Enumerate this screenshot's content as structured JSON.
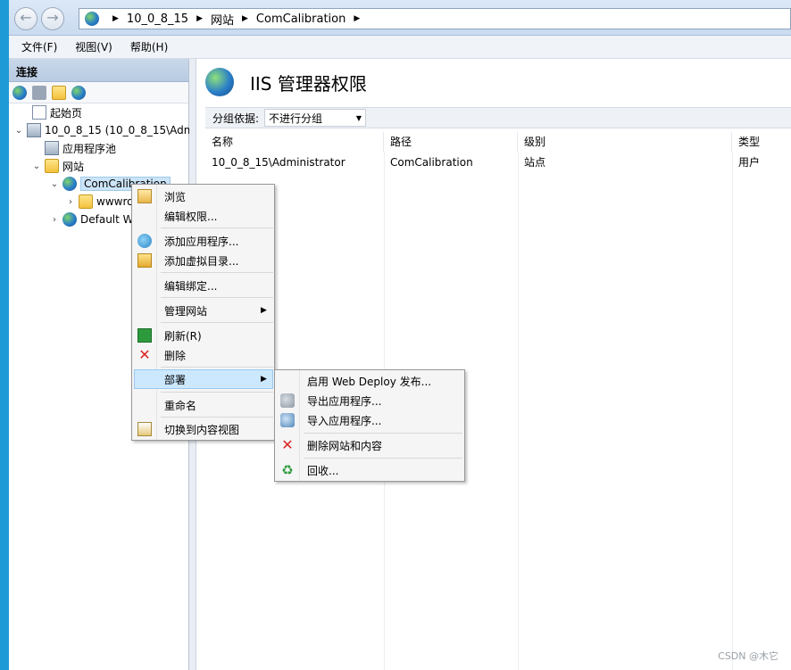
{
  "address": {
    "crumbs": [
      "10_0_8_15",
      "网站",
      "ComCalibration"
    ]
  },
  "menubar": [
    "文件(F)",
    "视图(V)",
    "帮助(H)"
  ],
  "connections": {
    "header": "连接",
    "tree": {
      "start_page": "起始页",
      "server": "10_0_8_15 (10_0_8_15\\Adm",
      "app_pools": "应用程序池",
      "sites": "网站",
      "site_selected": "ComCalibration",
      "child_folder": "wwwro",
      "default_site": "Default W"
    }
  },
  "main": {
    "title": "IIS 管理器权限",
    "group_by_label": "分组依据:",
    "group_by_value": "不进行分组",
    "columns": [
      "名称",
      "路径",
      "级别",
      "类型"
    ],
    "rows": [
      [
        "10_0_8_15\\Administrator",
        "ComCalibration",
        "站点",
        "用户"
      ]
    ]
  },
  "context_menu": {
    "items": [
      "浏览",
      "编辑权限...",
      "添加应用程序...",
      "添加虚拟目录...",
      "编辑绑定...",
      "管理网站",
      "刷新(R)",
      "删除",
      "部署",
      "重命名",
      "切换到内容视图"
    ]
  },
  "submenu": {
    "items": [
      "启用 Web Deploy 发布...",
      "导出应用程序...",
      "导入应用程序...",
      "删除网站和内容",
      "回收..."
    ]
  },
  "watermark": "CSDN @木它"
}
